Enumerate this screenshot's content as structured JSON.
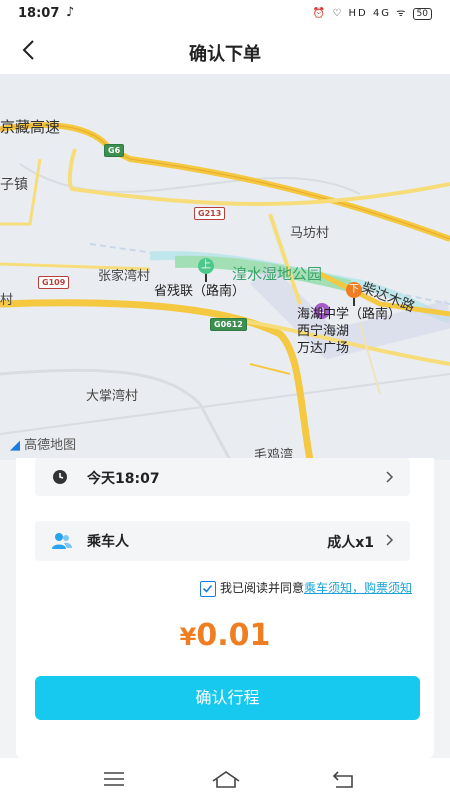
{
  "status_bar": {
    "time": "18:07",
    "app_icon": "tiktok-icon",
    "indicators": "⏰ ♡ HD 4G ᯤ",
    "battery": "50"
  },
  "header": {
    "title": "确认下单",
    "back_icon": "chevron-left-icon"
  },
  "map": {
    "labels": {
      "highway_top": "京藏高速",
      "town_left": "子镇",
      "village_mafang": "马坊村",
      "village_zhangjia": "张家湾村",
      "left_edge": "村",
      "park": "湟水湿地公园",
      "road_chaidamu": "柴达木路",
      "village_dazhang": "大掌湾村",
      "village_maoji": "毛鸡湾",
      "mall_line1": "西宁海湖",
      "mall_line2": "万达广场"
    },
    "shields": {
      "g6": "G6",
      "g213": "G213",
      "g109": "G109",
      "g0612": "G0612"
    },
    "pickup": {
      "badge": "上",
      "label": "省残联（路南）"
    },
    "dropoff": {
      "badge": "下",
      "label": "海湖中学（路南）"
    },
    "logo": {
      "prefix": "◢",
      "text": "高德地图"
    }
  },
  "order": {
    "time_row": {
      "icon": "clock-icon",
      "label": "今天18:07"
    },
    "passenger_row": {
      "icon": "passengers-icon",
      "label": "乘车人",
      "value": "成人x1"
    },
    "agreement": {
      "text": "我已阅读并同意",
      "link": "乘车须知，购票须知",
      "checked": true
    },
    "price": {
      "currency": "¥",
      "amount": "0.01"
    },
    "confirm_button": "确认行程"
  },
  "colors": {
    "accent": "#17c8ef",
    "price": "#ef7d22",
    "link": "#1aa3d6"
  }
}
